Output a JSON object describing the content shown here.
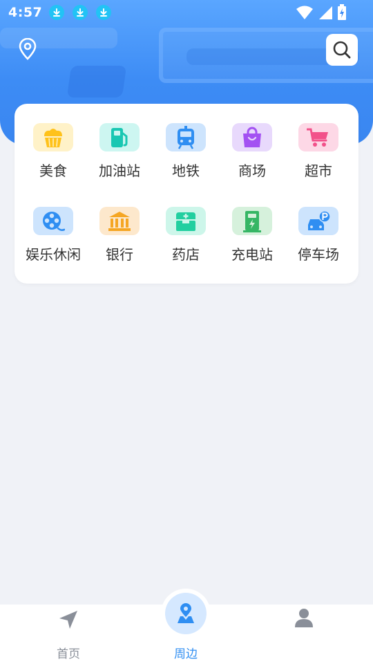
{
  "status_bar": {
    "time": "4:57",
    "icons": [
      "download-icon",
      "download-icon",
      "download-icon",
      "wifi-icon",
      "signal-icon",
      "battery-icon"
    ]
  },
  "header": {
    "location_icon": "location-pin-icon",
    "search_icon": "search-icon"
  },
  "categories": [
    {
      "label": "美食",
      "icon": "cupcake-icon",
      "tile_color": "#fff2c8",
      "icon_color": "#ffc21a"
    },
    {
      "label": "加油站",
      "icon": "fuel-pump-icon",
      "tile_color": "#cdf6f1",
      "icon_color": "#19c7b2"
    },
    {
      "label": "地铁",
      "icon": "train-icon",
      "tile_color": "#cde4fd",
      "icon_color": "#2f8ef2"
    },
    {
      "label": "商场",
      "icon": "shopping-bag-icon",
      "tile_color": "#e8d9fc",
      "icon_color": "#a351f2"
    },
    {
      "label": "超市",
      "icon": "shopping-cart-icon",
      "tile_color": "#fdd8e6",
      "icon_color": "#f2518a"
    },
    {
      "label": "娱乐休闲",
      "icon": "film-reel-icon",
      "tile_color": "#cde4fd",
      "icon_color": "#2f8ef2"
    },
    {
      "label": "银行",
      "icon": "bank-icon",
      "tile_color": "#fde8cc",
      "icon_color": "#f5a623"
    },
    {
      "label": "药店",
      "icon": "medicine-box-icon",
      "tile_color": "#cdf6ea",
      "icon_color": "#22cfa0"
    },
    {
      "label": "充电站",
      "icon": "charging-station-icon",
      "tile_color": "#d6f1dc",
      "icon_color": "#36b665"
    },
    {
      "label": "停车场",
      "icon": "parking-car-icon",
      "tile_color": "#cde4fd",
      "icon_color": "#2f8ef2"
    }
  ],
  "bottom_nav": {
    "home_label": "首页",
    "nearby_label": "周边",
    "mine_label": "",
    "active_color": "#2f8ef2",
    "inactive_color": "#8a8f99"
  }
}
